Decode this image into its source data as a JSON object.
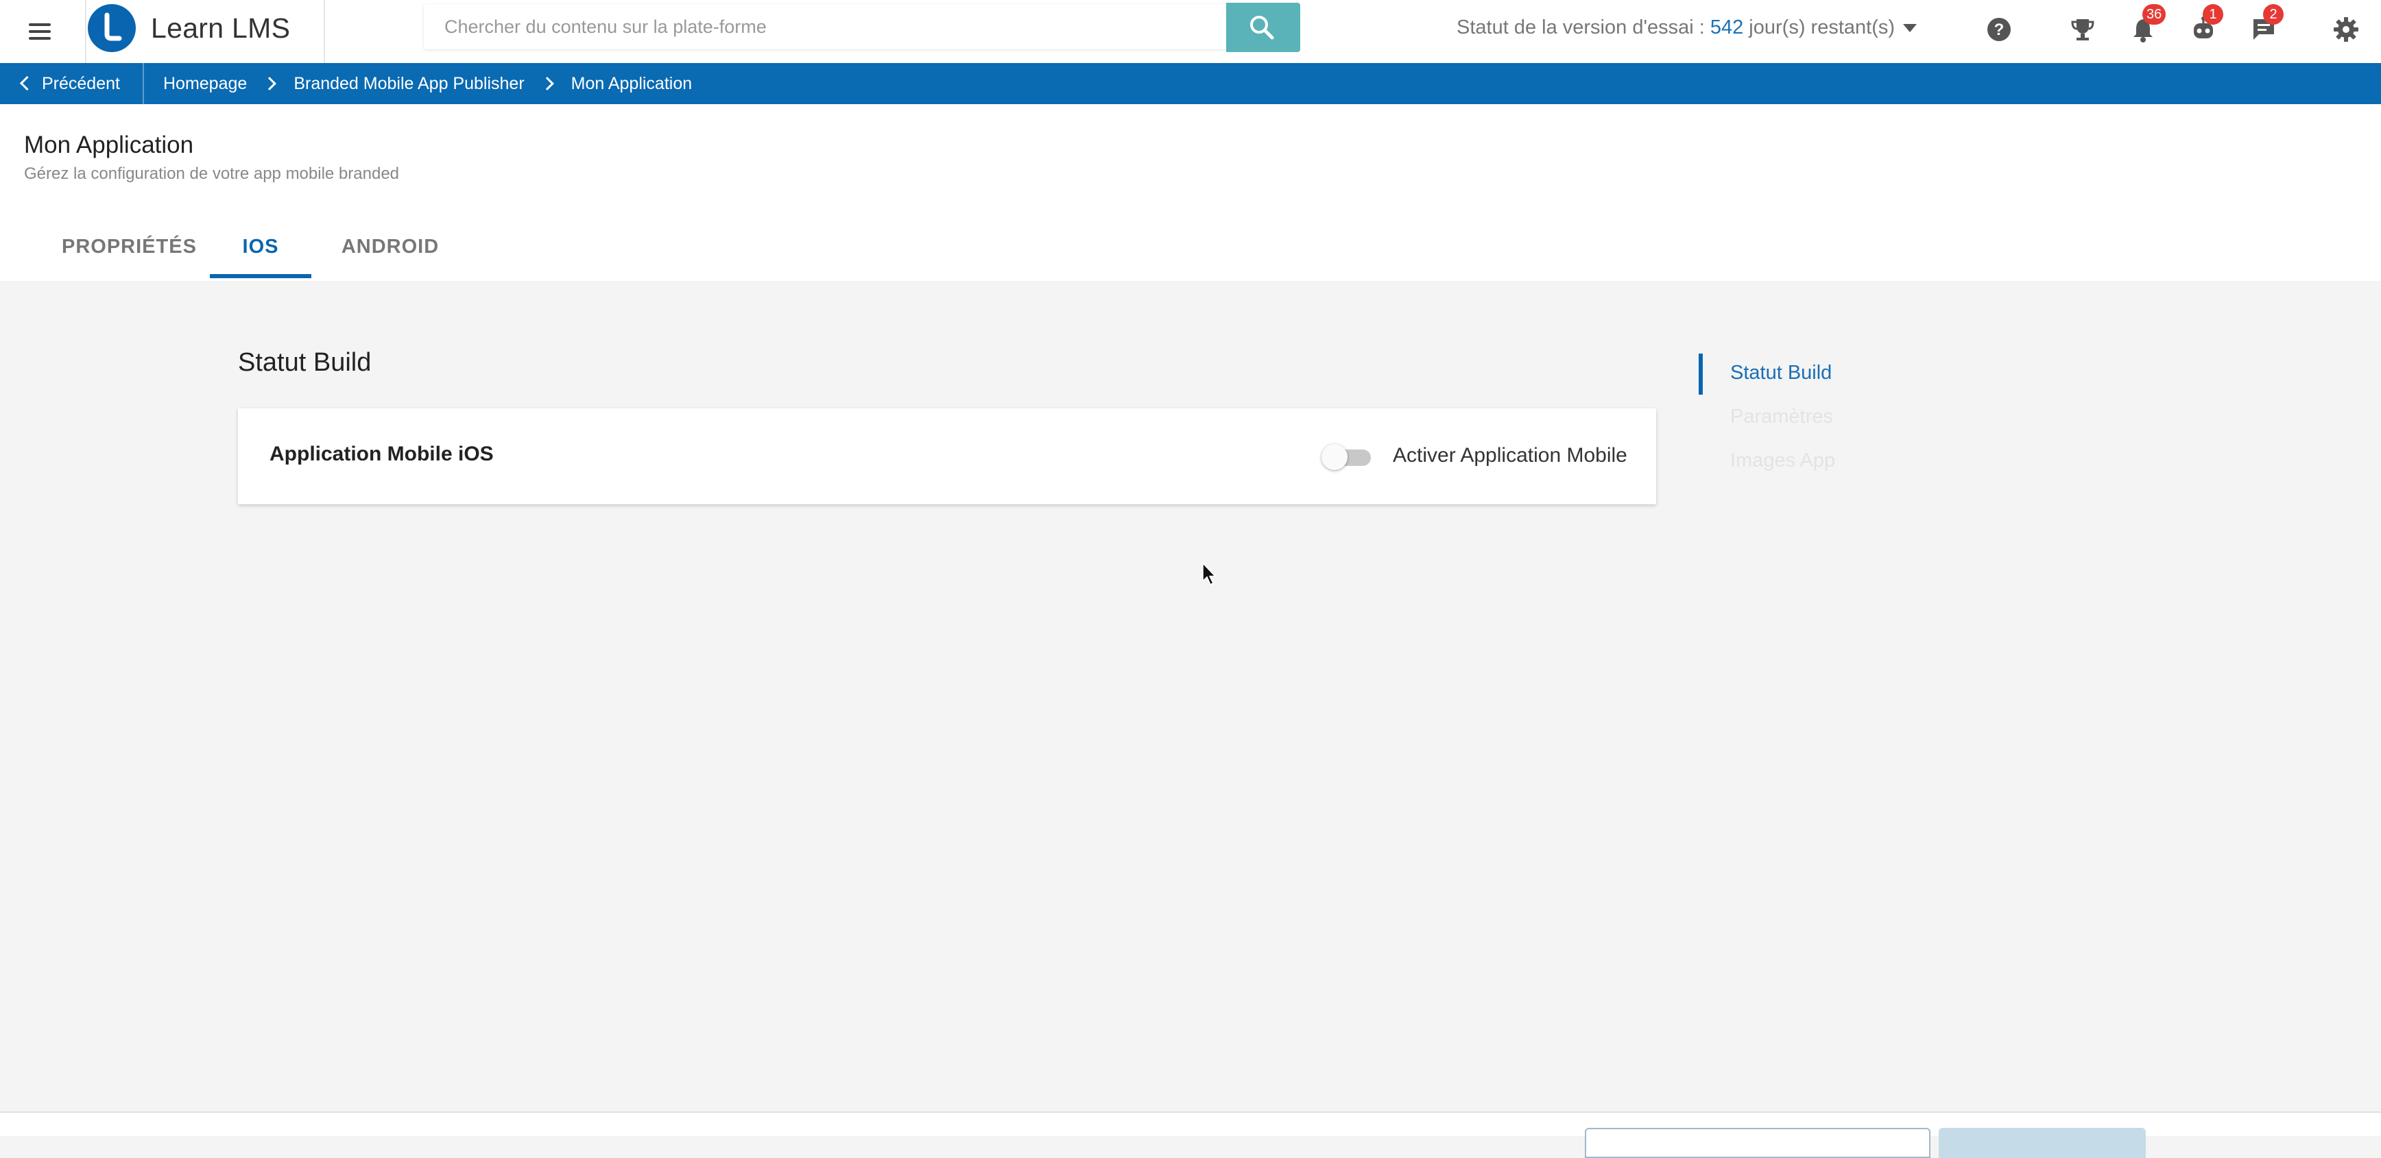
{
  "header": {
    "app_name": "Learn LMS",
    "search_placeholder": "Chercher du contenu sur la plate-forme",
    "trial_label": "Statut de la version d'essai : ",
    "trial_days": "542",
    "trial_suffix": " jour(s) restant(s)",
    "badges": {
      "notifications": "36",
      "robot": "1",
      "messages": "2"
    },
    "icons": [
      "menu-icon",
      "search-icon",
      "help-icon",
      "trophy-icon",
      "bell-icon",
      "robot-icon",
      "chat-icon",
      "gear-icon"
    ]
  },
  "breadcrumb": {
    "back_label": "Précédent",
    "items": [
      "Homepage",
      "Branded Mobile App Publisher",
      "Mon Application"
    ]
  },
  "page": {
    "title": "Mon Application",
    "subtitle": "Gérez la configuration de votre app mobile branded",
    "tabs": [
      "PROPRIÉTÉS",
      "IOS",
      "ANDROID"
    ],
    "active_tab": "IOS"
  },
  "section": {
    "title": "Statut Build",
    "card_label": "Application Mobile iOS",
    "toggle_label": "Activer Application Mobile",
    "toggle_on": false
  },
  "anchors": [
    "Statut Build",
    "Paramètres",
    "Images App"
  ],
  "colors": {
    "primary": "#0a65b0",
    "search_button": "#5ab3b8",
    "badge": "#e53935",
    "background": "#f4f4f4"
  }
}
